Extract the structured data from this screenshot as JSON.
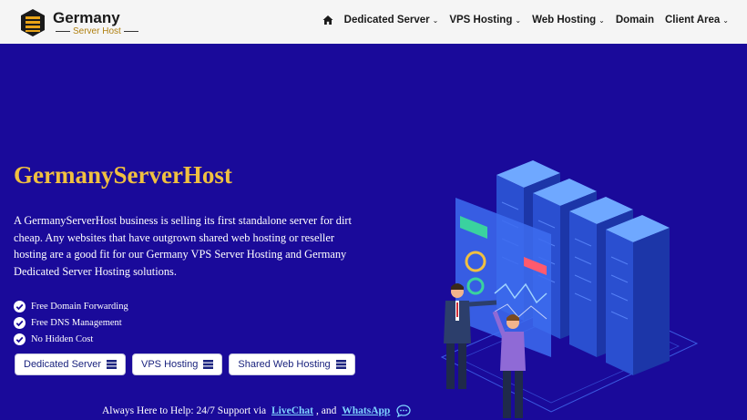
{
  "header": {
    "logo_title": "Germany",
    "logo_subtitle": "Server Host",
    "nav": [
      {
        "label": "Dedicated Server",
        "chevron": "⌄"
      },
      {
        "label": "VPS Hosting",
        "chevron": "⌄"
      },
      {
        "label": "Web Hosting",
        "chevron": "⌄"
      },
      {
        "label": "Domain"
      },
      {
        "label": "Client Area",
        "chevron": "⌄"
      }
    ],
    "home_icon": "home-icon"
  },
  "hero": {
    "title": "GermanyServerHost",
    "description": "A GermanyServerHost business is selling its first standalone server for dirt cheap. Any websites that have outgrown shared web hosting or reseller hosting are a good fit for our Germany VPS Server Hosting and Germany Dedicated Server Hosting solutions.",
    "features": [
      "Free Domain Forwarding",
      "Free DNS Management",
      "No Hidden Cost"
    ],
    "buttons": [
      {
        "label": "Dedicated Server",
        "icon": "server-icon"
      },
      {
        "label": "VPS Hosting",
        "icon": "server-icon"
      },
      {
        "label": "Shared Web Hosting",
        "icon": "server-icon"
      }
    ],
    "support": {
      "prefix": "Always Here to Help: 24/7 Support via",
      "livechat": "LiveChat",
      "separator": ", and",
      "whatsapp": "WhatsApp",
      "icon": "chat-icon"
    }
  },
  "colors": {
    "background": "#1a0a9a",
    "title": "#f0c040",
    "link": "#7fd3ff",
    "header_bg": "#f5f5f5"
  }
}
